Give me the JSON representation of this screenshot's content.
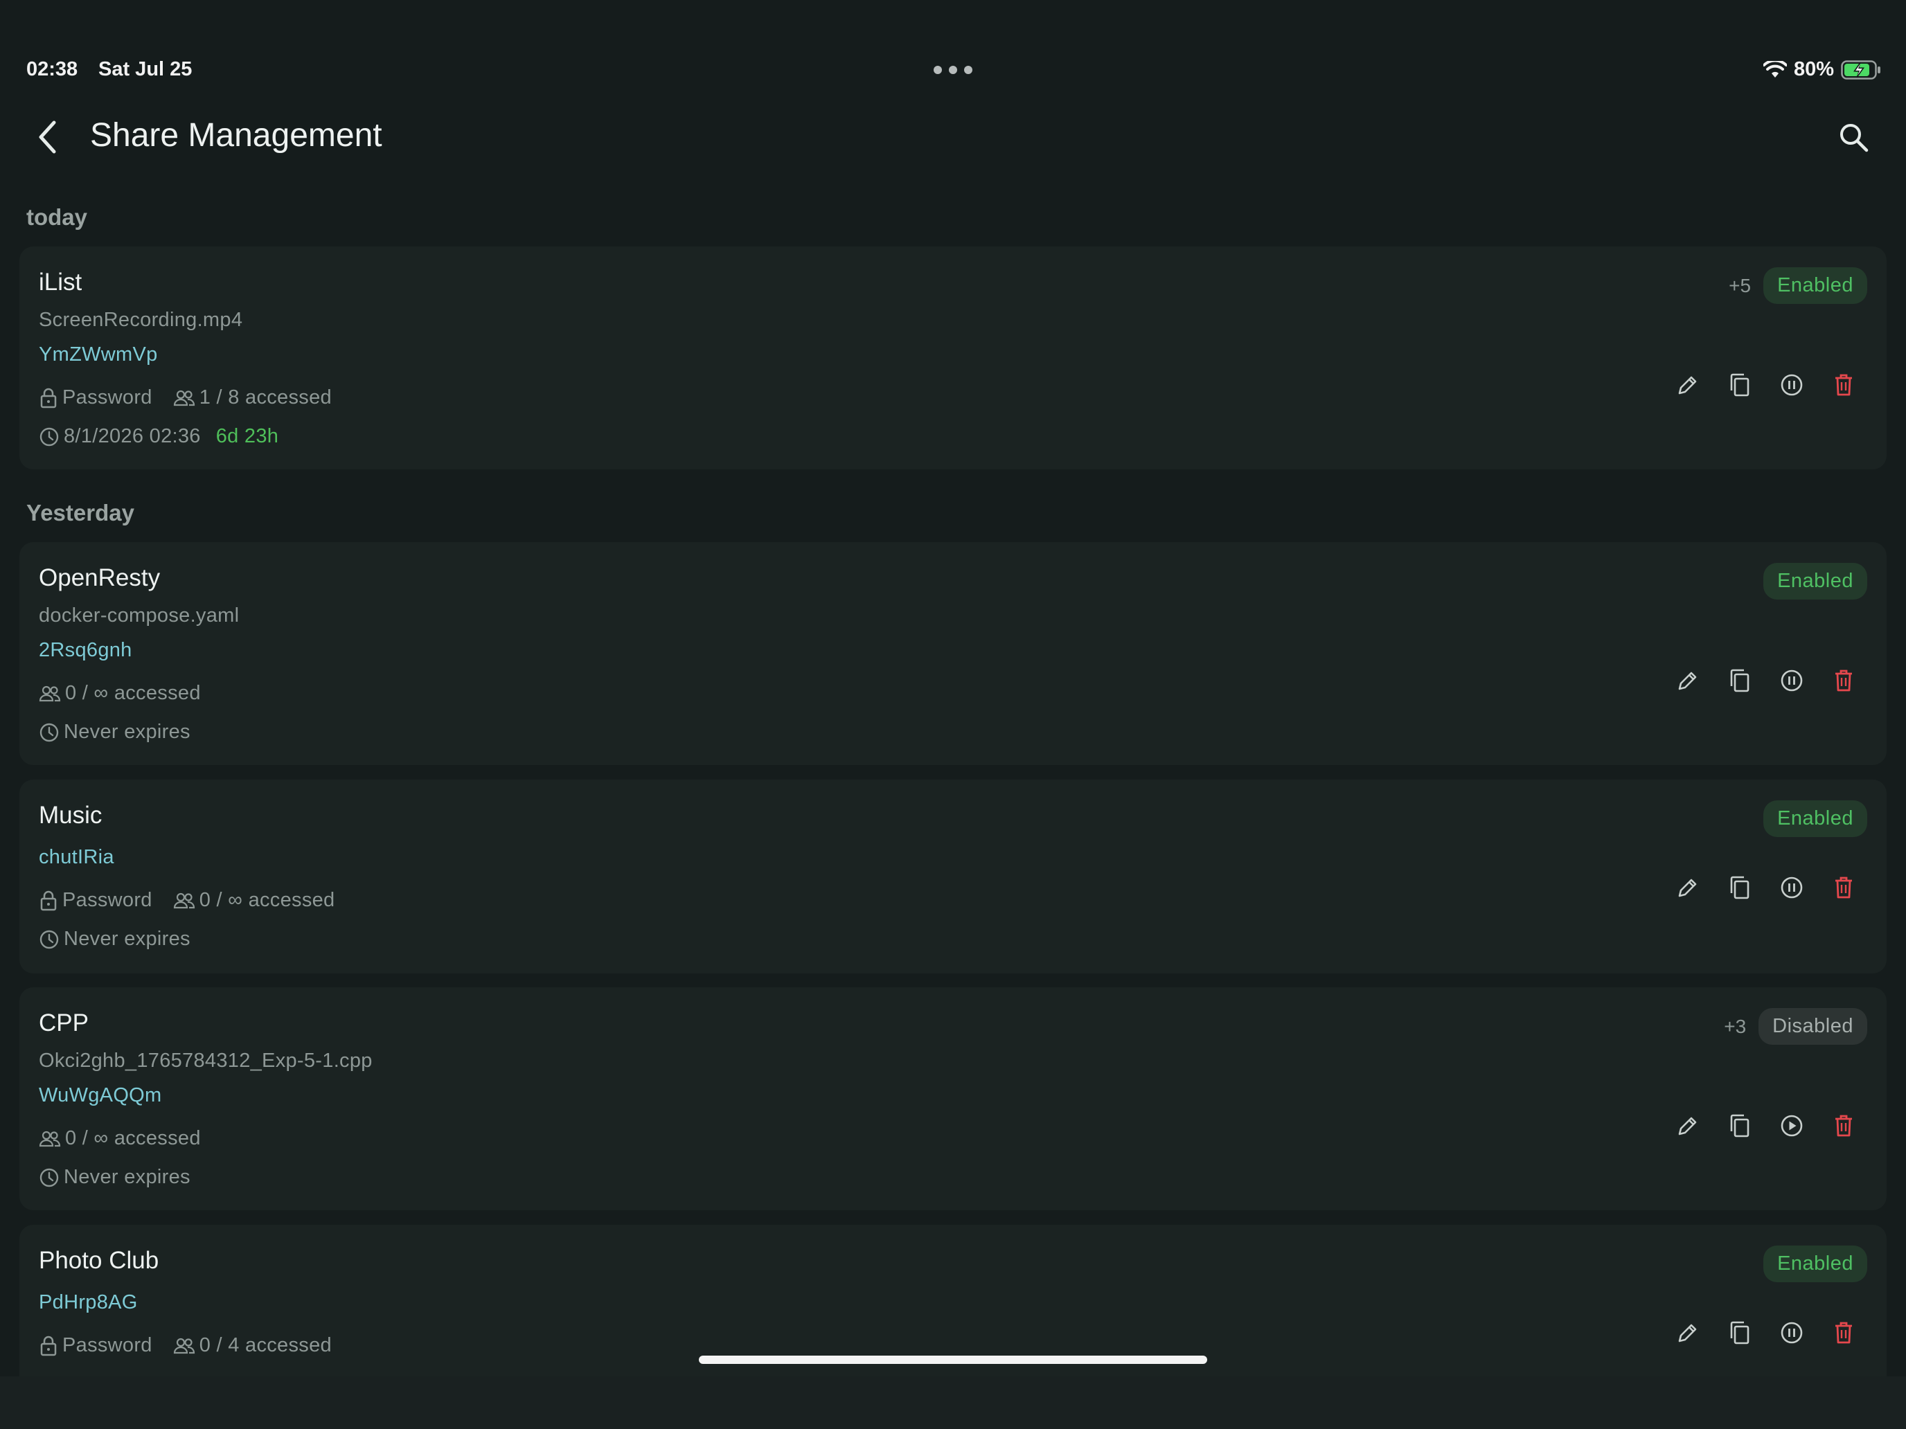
{
  "status_bar": {
    "time": "02:38",
    "date": "Sat Jul 25",
    "battery": "80%"
  },
  "header": {
    "title": "Share Management"
  },
  "sections": [
    {
      "label": "today",
      "cards": [
        {
          "title": "iList",
          "file": "ScreenRecording.mp4",
          "code": "YmZWwmVp",
          "extra": "+5",
          "status": "Enabled",
          "password": "Password",
          "accessed": "1 / 8 accessed",
          "expires": "8/1/2026 02:36",
          "remaining": "6d 23h"
        }
      ]
    },
    {
      "label": "Yesterday",
      "cards": [
        {
          "title": "OpenResty",
          "file": "docker-compose.yaml",
          "code": "2Rsq6gnh",
          "status": "Enabled",
          "accessed": "0 / ∞ accessed",
          "expires": "Never expires"
        },
        {
          "title": "Music",
          "code": "chutIRia",
          "status": "Enabled",
          "password": "Password",
          "accessed": "0 / ∞ accessed",
          "expires": "Never expires"
        },
        {
          "title": "CPP",
          "file": "Okci2ghb_1765784312_Exp-5-1.cpp",
          "code": "WuWgAQQm",
          "extra": "+3",
          "status": "Disabled",
          "accessed": "0 / ∞ accessed",
          "expires": "Never expires"
        },
        {
          "title": "Photo Club",
          "code": "PdHrp8AG",
          "status": "Enabled",
          "password": "Password",
          "accessed": "0 / 4 accessed"
        }
      ]
    }
  ],
  "colors": {
    "enabled": "#4fc063",
    "remaining": "#4fbf5a",
    "code": "#7ecbd6",
    "delete": "#e5484d"
  }
}
